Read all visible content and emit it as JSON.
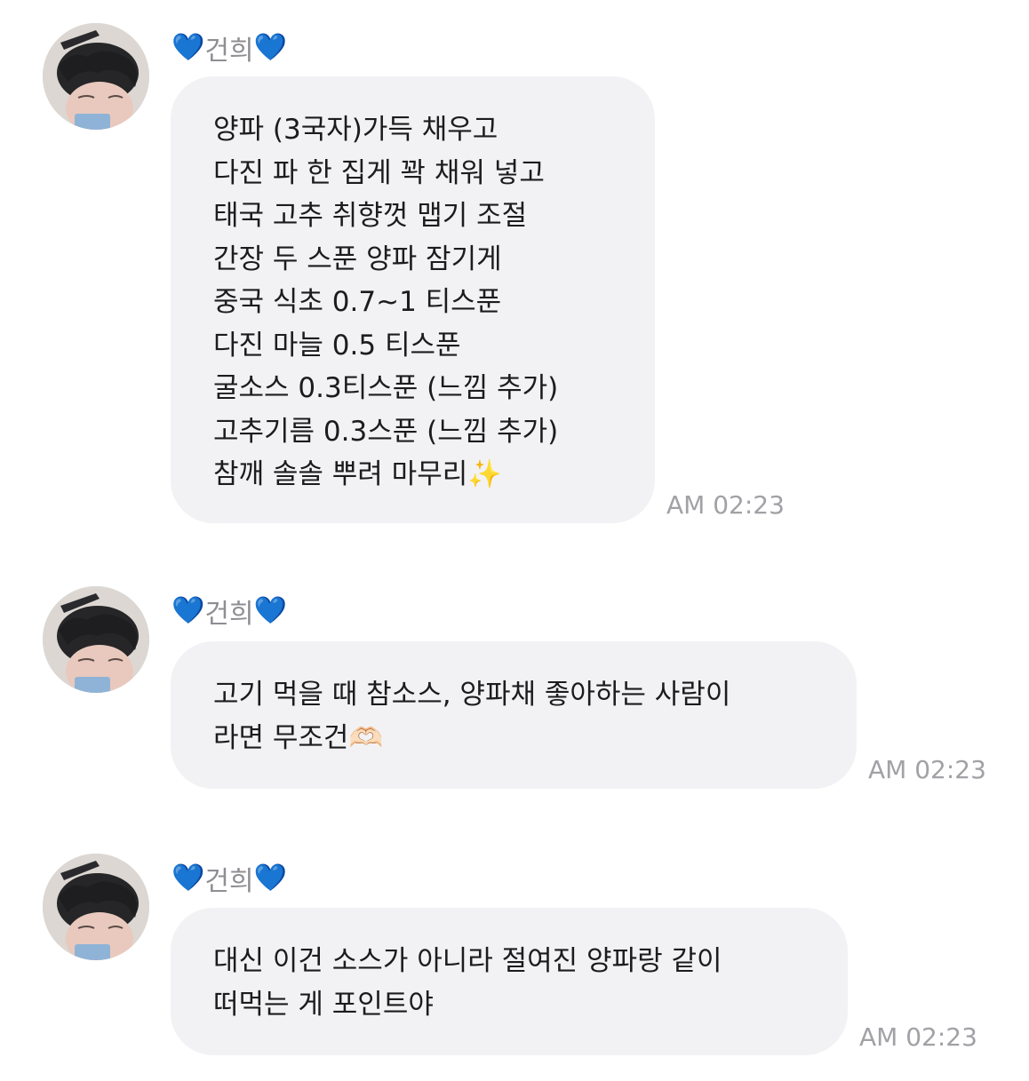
{
  "messages": [
    {
      "sender": "건희",
      "sender_icon_left": "💙",
      "sender_icon_right": "💙",
      "lines": [
        "양파 (3국자)가득 채우고",
        "다진 파 한 집게 꽉 채워 넣고",
        "태국 고추 취향껏 맵기 조절",
        "간장 두 스푼 양파 잠기게",
        "중국 식초 0.7~1 티스푼",
        "다진 마늘 0.5 티스푼",
        "굴소스 0.3티스푼 (느낌 추가)",
        "고추기름 0.3스푼 (느낌 추가)",
        "참깨 솔솔 뿌려 마무리✨"
      ],
      "time": "AM 02:23"
    },
    {
      "sender": "건희",
      "sender_icon_left": "💙",
      "sender_icon_right": "💙",
      "lines": [
        "고기 먹을 때 참소스, 양파채 좋아하는 사람이",
        "라면 무조건🫶🏻"
      ],
      "time": "AM 02:23"
    },
    {
      "sender": "건희",
      "sender_icon_left": "💙",
      "sender_icon_right": "💙",
      "lines": [
        "대신 이건 소스가 아니라 절여진 양파랑 같이",
        "떠먹는 게 포인트야"
      ],
      "time": "AM 02:23"
    }
  ],
  "colors": {
    "bubble": "#f2f2f4",
    "text": "#1c1c1e",
    "time": "#a1a1a6",
    "sender": "#8e8e93",
    "heart": "#1a78f2"
  }
}
